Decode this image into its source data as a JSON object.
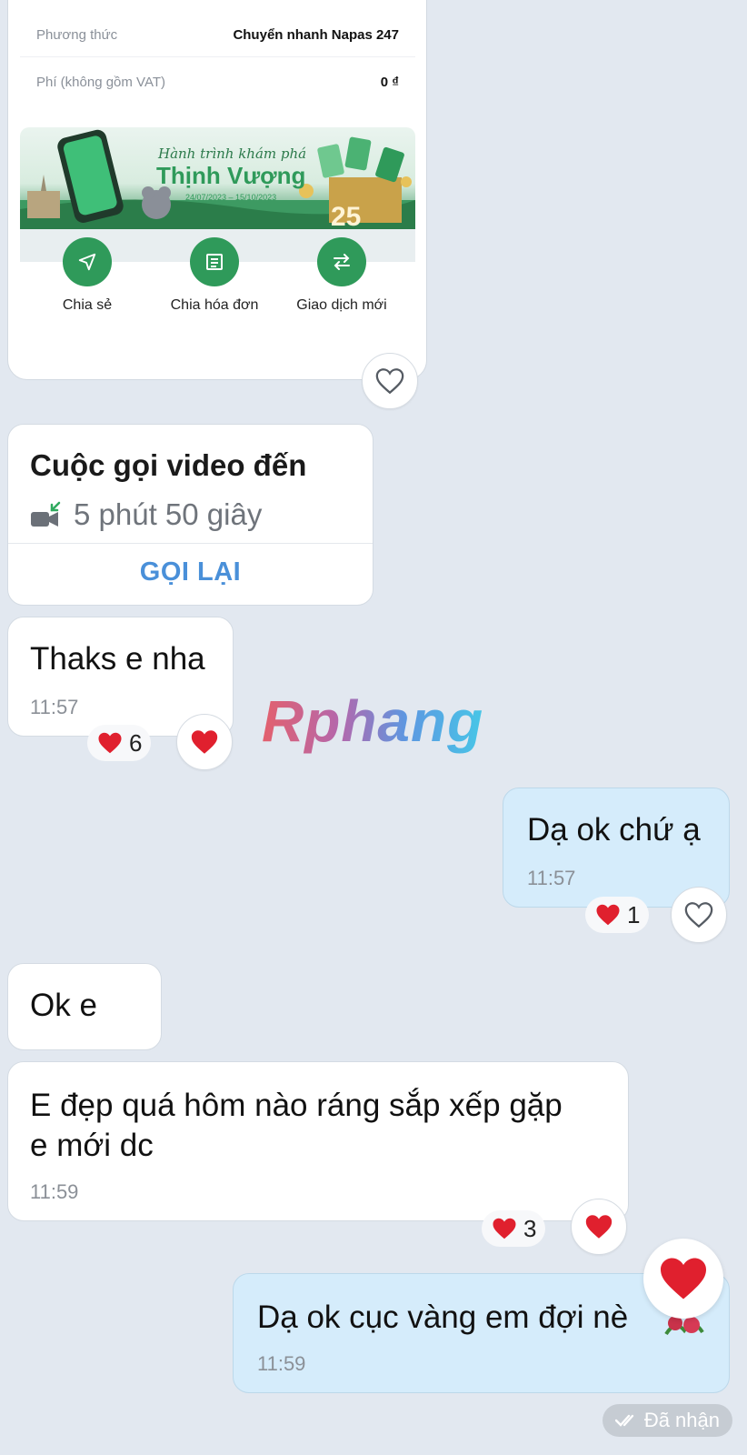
{
  "receipt": {
    "rows": [
      {
        "label": "Phương thức",
        "value": "Chuyển nhanh Napas 247"
      },
      {
        "label": "Phí (không gồm VAT)",
        "value": "0 ₫"
      }
    ],
    "banner": {
      "tagline": "Hành trình khám phá",
      "title": "Thịnh Vượng",
      "dates": "24/07/2023 – 15/10/2023",
      "promo": "25"
    },
    "actions": [
      {
        "label": "Chia sẻ",
        "icon": "send-icon"
      },
      {
        "label": "Chia hóa đơn",
        "icon": "bill-split-icon"
      },
      {
        "label": "Giao dịch mới",
        "icon": "swap-icon"
      }
    ]
  },
  "call_card": {
    "title": "Cuộc gọi video đến",
    "duration": "5 phút 50 giây",
    "action": "GỌI LẠI",
    "icon": "incoming-video-call-icon"
  },
  "messages": [
    {
      "id": "m1",
      "direction": "in",
      "text": "Thaks e nha",
      "time": "11:57",
      "reaction_count": "6"
    },
    {
      "id": "m2",
      "direction": "out",
      "text": "Dạ ok chứ ạ",
      "time": "11:57",
      "reaction_count": "1"
    },
    {
      "id": "m3",
      "direction": "in",
      "text": "Ok e"
    },
    {
      "id": "m4",
      "direction": "in",
      "text_line1": "E đẹp quá hôm nào ráng sắp xếp gặp",
      "text_line2": "e mới dc",
      "time": "11:59",
      "reaction_count": "3"
    },
    {
      "id": "m5",
      "direction": "out",
      "text": "Dạ ok cục vàng em đợi nè",
      "time": "11:59"
    }
  ],
  "status": {
    "label": "Đã nhận"
  },
  "watermark": "Rphang",
  "colors": {
    "accent_green": "#2f9a5a",
    "link_blue": "#4a90d9",
    "heart_red": "#e0202e",
    "outgoing_bubble": "#d5ecfb"
  }
}
